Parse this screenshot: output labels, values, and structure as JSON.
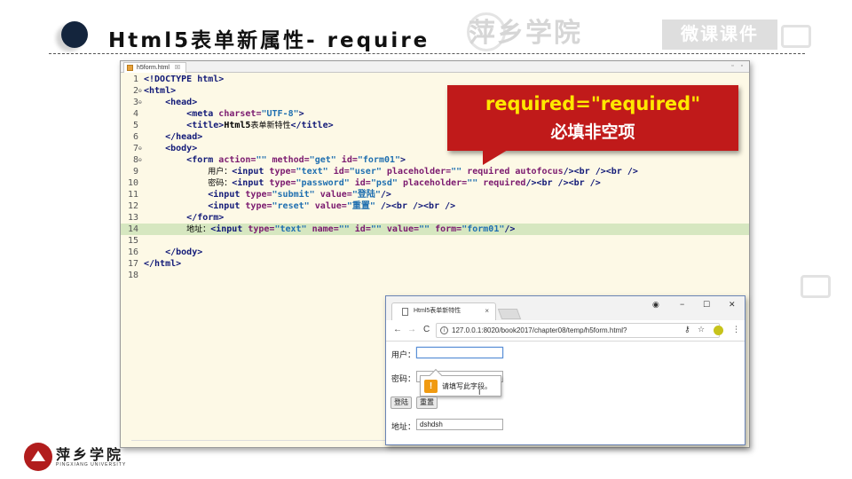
{
  "slide": {
    "title": "Html5表单新属性- require",
    "watermark_top": "萍乡学院",
    "watermark_box": "微课课件"
  },
  "editor": {
    "tab_label": "h5form.html",
    "tab_close": "☒",
    "window_controls": "▫ ▫",
    "lines": [
      {
        "n": "1",
        "fold": "",
        "segs": [
          {
            "t": "<!DOCTYPE html>",
            "c": "tag"
          }
        ]
      },
      {
        "n": "2",
        "fold": "⊖",
        "segs": [
          {
            "t": "<html>",
            "c": "tag"
          }
        ]
      },
      {
        "n": "3",
        "fold": "⊖",
        "segs": [
          {
            "t": "    ",
            "c": "txt"
          },
          {
            "t": "<head>",
            "c": "tag"
          }
        ]
      },
      {
        "n": "4",
        "fold": "",
        "segs": [
          {
            "t": "        ",
            "c": "txt"
          },
          {
            "t": "<meta ",
            "c": "tag"
          },
          {
            "t": "charset=",
            "c": "attr"
          },
          {
            "t": "\"UTF-8\"",
            "c": "val"
          },
          {
            "t": ">",
            "c": "tag"
          }
        ]
      },
      {
        "n": "5",
        "fold": "",
        "segs": [
          {
            "t": "        ",
            "c": "txt"
          },
          {
            "t": "<title>",
            "c": "tag"
          },
          {
            "t": "Html5",
            "c": "txt"
          },
          {
            "t": "表单新特性",
            "c": "cn"
          },
          {
            "t": "</title>",
            "c": "tag"
          }
        ]
      },
      {
        "n": "6",
        "fold": "",
        "segs": [
          {
            "t": "    ",
            "c": "txt"
          },
          {
            "t": "</head>",
            "c": "tag"
          }
        ]
      },
      {
        "n": "7",
        "fold": "⊖",
        "segs": [
          {
            "t": "    ",
            "c": "txt"
          },
          {
            "t": "<body>",
            "c": "tag"
          }
        ]
      },
      {
        "n": "8",
        "fold": "⊖",
        "segs": [
          {
            "t": "        ",
            "c": "txt"
          },
          {
            "t": "<form ",
            "c": "tag"
          },
          {
            "t": "action=",
            "c": "attr"
          },
          {
            "t": "\"\" ",
            "c": "val"
          },
          {
            "t": "method=",
            "c": "attr"
          },
          {
            "t": "\"get\" ",
            "c": "val"
          },
          {
            "t": "id=",
            "c": "attr"
          },
          {
            "t": "\"form01\"",
            "c": "val"
          },
          {
            "t": ">",
            "c": "tag"
          }
        ]
      },
      {
        "n": "9",
        "fold": "",
        "segs": [
          {
            "t": "            ",
            "c": "txt"
          },
          {
            "t": "用户：",
            "c": "cn"
          },
          {
            "t": "<input ",
            "c": "tag"
          },
          {
            "t": "type=",
            "c": "attr"
          },
          {
            "t": "\"text\" ",
            "c": "val"
          },
          {
            "t": "id=",
            "c": "attr"
          },
          {
            "t": "\"user\" ",
            "c": "val"
          },
          {
            "t": "placeholder=",
            "c": "attr"
          },
          {
            "t": "\"\" ",
            "c": "val"
          },
          {
            "t": "required autofocus",
            "c": "attr"
          },
          {
            "t": "/><br /><br />",
            "c": "tag"
          }
        ]
      },
      {
        "n": "10",
        "fold": "",
        "segs": [
          {
            "t": "            ",
            "c": "txt"
          },
          {
            "t": "密码：",
            "c": "cn"
          },
          {
            "t": "<input ",
            "c": "tag"
          },
          {
            "t": "type=",
            "c": "attr"
          },
          {
            "t": "\"password\" ",
            "c": "val"
          },
          {
            "t": "id=",
            "c": "attr"
          },
          {
            "t": "\"psd\" ",
            "c": "val"
          },
          {
            "t": "placeholder=",
            "c": "attr"
          },
          {
            "t": "\"\" ",
            "c": "val"
          },
          {
            "t": "required",
            "c": "attr"
          },
          {
            "t": "/><br /><br />",
            "c": "tag"
          }
        ]
      },
      {
        "n": "11",
        "fold": "",
        "segs": [
          {
            "t": "            ",
            "c": "txt"
          },
          {
            "t": "<input ",
            "c": "tag"
          },
          {
            "t": "type=",
            "c": "attr"
          },
          {
            "t": "\"submit\" ",
            "c": "val"
          },
          {
            "t": "value=",
            "c": "attr"
          },
          {
            "t": "\"登陆\"",
            "c": "val"
          },
          {
            "t": "/>",
            "c": "tag"
          }
        ]
      },
      {
        "n": "12",
        "fold": "",
        "segs": [
          {
            "t": "            ",
            "c": "txt"
          },
          {
            "t": "<input ",
            "c": "tag"
          },
          {
            "t": "type=",
            "c": "attr"
          },
          {
            "t": "\"reset\" ",
            "c": "val"
          },
          {
            "t": "value=",
            "c": "attr"
          },
          {
            "t": "\"重置\" ",
            "c": "val"
          },
          {
            "t": "/><br /><br />",
            "c": "tag"
          }
        ]
      },
      {
        "n": "13",
        "fold": "",
        "segs": [
          {
            "t": "        ",
            "c": "txt"
          },
          {
            "t": "</form>",
            "c": "tag"
          }
        ]
      },
      {
        "n": "14",
        "fold": "",
        "hl": true,
        "segs": [
          {
            "t": "        ",
            "c": "txt"
          },
          {
            "t": "地址：",
            "c": "cn"
          },
          {
            "t": "<input ",
            "c": "tag"
          },
          {
            "t": "type=",
            "c": "attr"
          },
          {
            "t": "\"text\" ",
            "c": "val"
          },
          {
            "t": "name=",
            "c": "attr"
          },
          {
            "t": "\"\" ",
            "c": "val"
          },
          {
            "t": "id=",
            "c": "attr"
          },
          {
            "t": "\"\" ",
            "c": "val"
          },
          {
            "t": "value=",
            "c": "attr"
          },
          {
            "t": "\"\" ",
            "c": "val"
          },
          {
            "t": "form=",
            "c": "attr"
          },
          {
            "t": "\"form01\"",
            "c": "val"
          },
          {
            "t": "/>",
            "c": "tag"
          }
        ]
      },
      {
        "n": "15",
        "fold": "",
        "segs": []
      },
      {
        "n": "16",
        "fold": "",
        "segs": [
          {
            "t": "    ",
            "c": "txt"
          },
          {
            "t": "</body>",
            "c": "tag"
          }
        ]
      },
      {
        "n": "17",
        "fold": "",
        "segs": [
          {
            "t": "</html>",
            "c": "tag"
          }
        ]
      },
      {
        "n": "18",
        "fold": "",
        "segs": []
      }
    ]
  },
  "callout": {
    "line1": "required=\"required\"",
    "line2": "必填非空项",
    "bg_color": "#c01a1a",
    "accent_color": "#ffe800"
  },
  "browser": {
    "tab_title": "Html5表单新特性",
    "tab_close": "×",
    "profile_icon": "◉",
    "minimize": "−",
    "maximize": "☐",
    "close": "✕",
    "back": "←",
    "forward": "→",
    "reload": "C",
    "url": "127.0.0.1:8020/book2017/chapter08/temp/h5form.html?",
    "url_info": "i",
    "key_icon": "⚷",
    "star_icon": "☆",
    "menu_icon": "⋮",
    "form": {
      "user_label": "用户：",
      "user_value": "",
      "password_label": "密码：",
      "password_value": "",
      "submit_label": "登陆",
      "reset_label": "重置",
      "address_label": "地址：",
      "address_value": "dshdsh"
    },
    "tooltip": {
      "icon": "!",
      "text": "请填写此字段。"
    }
  },
  "logo": {
    "name": "萍乡学院",
    "sub": "PINGXIANG UNIVERSITY"
  }
}
